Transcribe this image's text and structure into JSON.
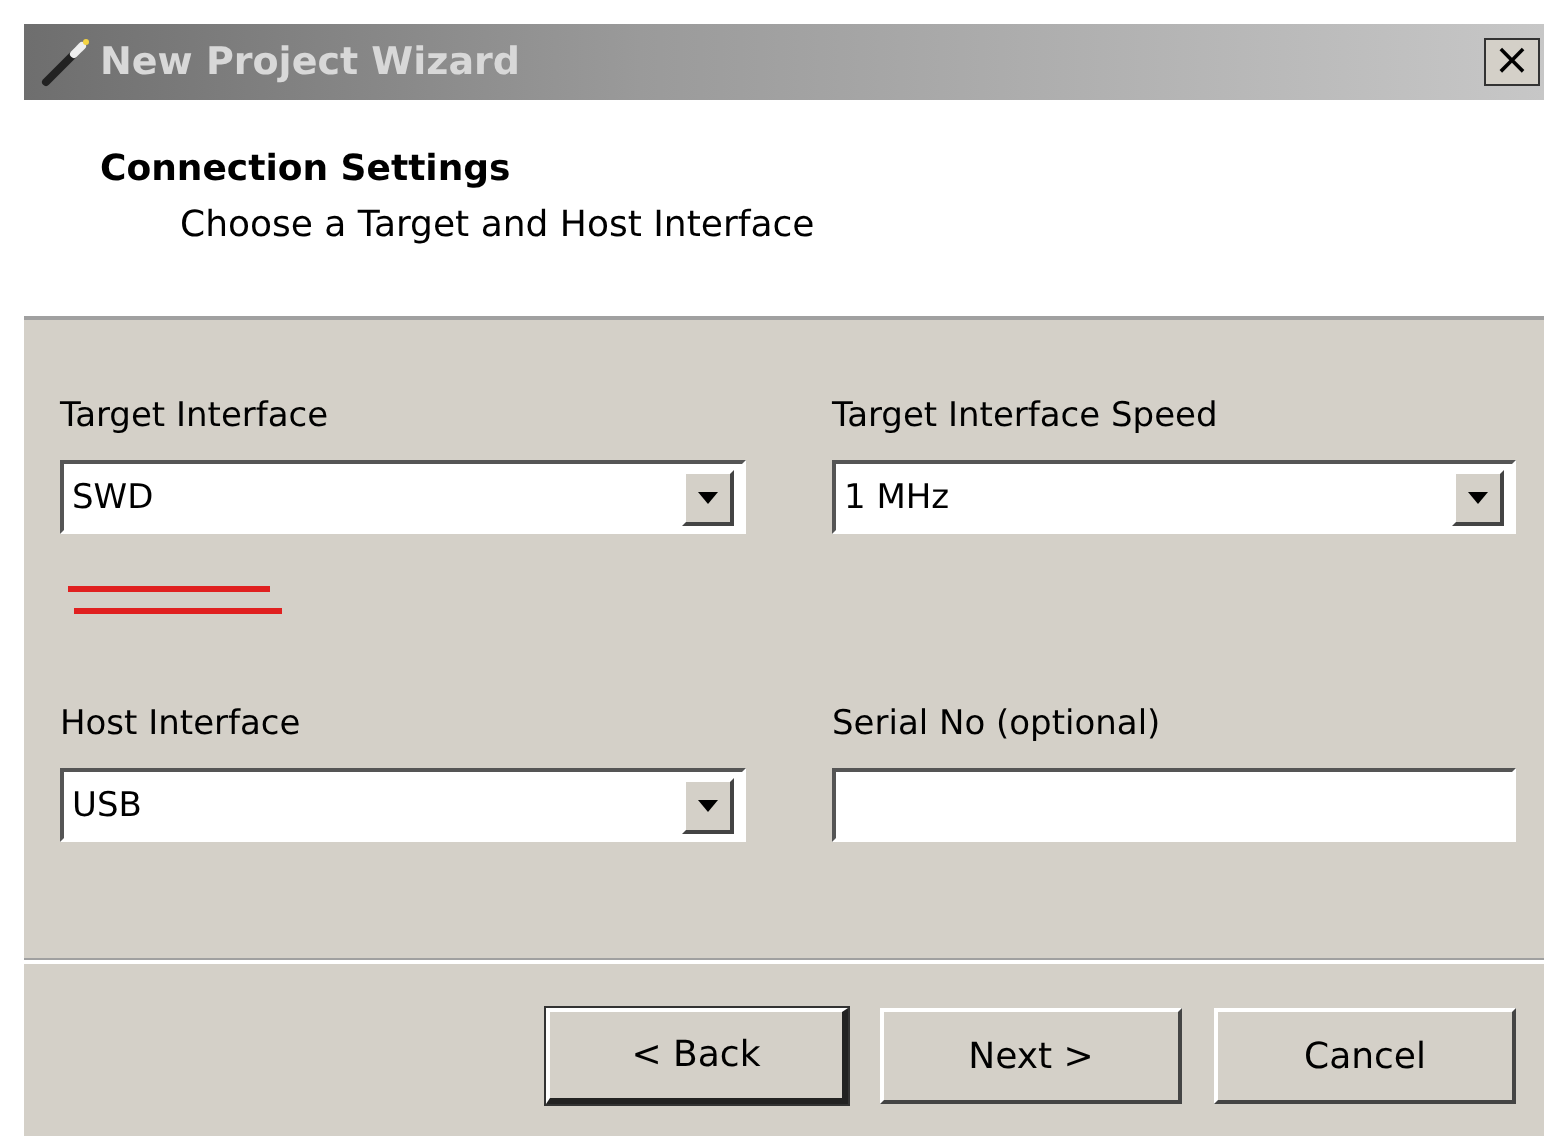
{
  "window": {
    "title": "New Project Wizard",
    "close": "×"
  },
  "header": {
    "title": "Connection Settings",
    "subtitle": "Choose a Target and Host Interface"
  },
  "fields": [
    {
      "kind": "dropdown",
      "label": "Target Interface",
      "value": "SWD"
    },
    {
      "kind": "dropdown",
      "label": "Target Interface Speed",
      "value": "1 MHz"
    },
    {
      "kind": "dropdown",
      "label": "Host Interface",
      "value": "USB"
    },
    {
      "kind": "text",
      "label": "Serial No (optional)"
    }
  ],
  "buttons": [
    {
      "label": "< Back",
      "default": true
    },
    {
      "label": "Next >",
      "default": false
    },
    {
      "label": "Cancel",
      "default": false
    }
  ]
}
